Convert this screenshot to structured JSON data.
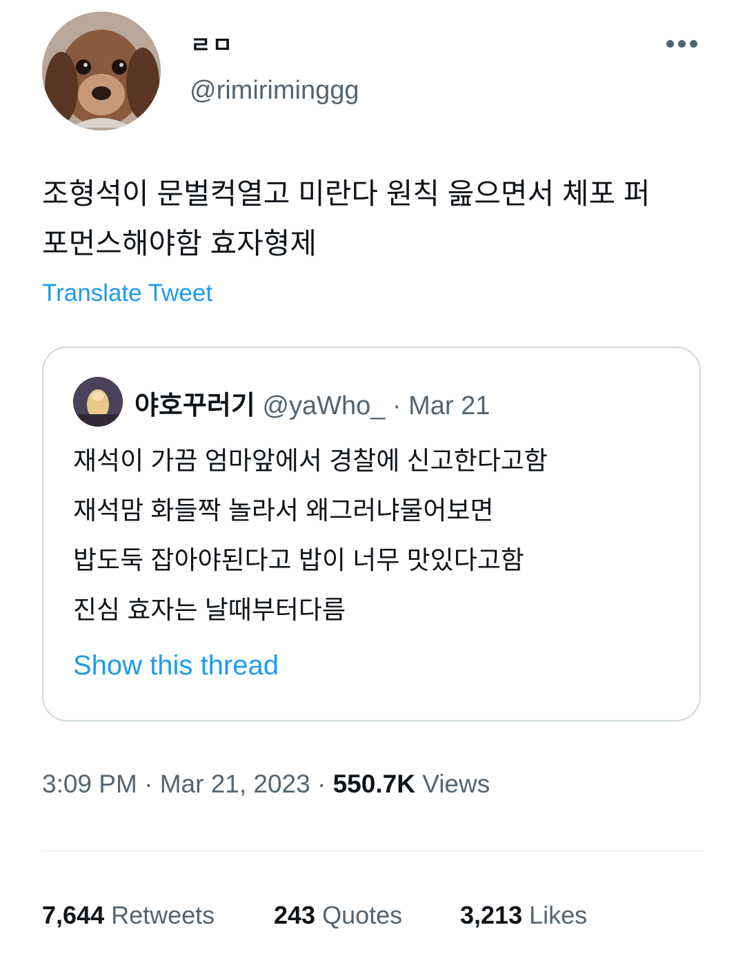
{
  "author": {
    "display_name": "ㄹㅁ",
    "handle": "@rimiriminggg"
  },
  "tweet": {
    "lines": [
      "조형석이 문벌컥열고 미란다 원칙 읊으면서 체포 퍼",
      "포먼스해야함 효자형제"
    ],
    "translate_label": "Translate Tweet"
  },
  "quote": {
    "display_name": "야호꾸러기",
    "handle": "@yaWho_",
    "separator": "·",
    "date": "Mar 21",
    "lines": [
      "재석이 가끔 엄마앞에서 경찰에 신고한다고함",
      "재석맘 화들짝 놀라서 왜그러냐물어보면",
      "밥도둑 잡아야된다고 밥이 너무 맛있다고함",
      "진심 효자는 날때부터다름"
    ],
    "show_thread": "Show this thread"
  },
  "meta": {
    "time": "3:09 PM",
    "sep1": "·",
    "date": "Mar 21, 2023",
    "sep2": "·",
    "views_count": "550.7K",
    "views_label": "Views"
  },
  "stats": {
    "retweets_count": "7,644",
    "retweets_label": "Retweets",
    "quotes_count": "243",
    "quotes_label": "Quotes",
    "likes_count": "3,213",
    "likes_label": "Likes"
  },
  "icons": {
    "more": "more-horizontal-icon",
    "author_avatar": "dachshund-puppy-avatar",
    "quote_avatar": "quote-author-avatar"
  },
  "colors": {
    "link": "#1d9bf0",
    "secondary_text": "#536471",
    "primary_text": "#0f1419",
    "border": "#cfd9de"
  }
}
